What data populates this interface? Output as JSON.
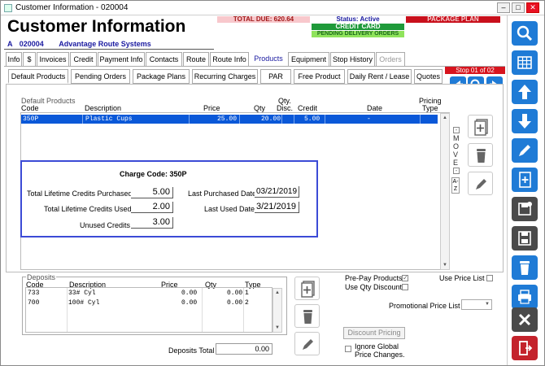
{
  "window": {
    "title": "Customer Information - 020004"
  },
  "header": {
    "title": "Customer Information",
    "account_type": "A",
    "account_number": "020004",
    "account_name": "Advantage Route Systems",
    "total_due": "TOTAL DUE: 620.64",
    "status": "Status: Active",
    "package_plan": "PACKAGE PLAN",
    "credit_card": "CREDIT CARD",
    "pending_orders": "PENDING DELIVERY ORDERS",
    "colors": {
      "total_due_bg": "#f8c8cc",
      "status_fg": "#1a1aa0",
      "package_bg": "#c9101c",
      "credit_bg": "#1f9a3a",
      "pending_bg": "#8fe35b"
    }
  },
  "tabs": [
    "Info",
    "$",
    "Invoices",
    "Credit",
    "Payment Info",
    "Contacts",
    "Route",
    "Route Info",
    "Products",
    "Equipment",
    "Stop History",
    "Orders"
  ],
  "subtabs": [
    "Default Products",
    "Pending Orders",
    "Package Plans",
    "Recurring Charges",
    "PAR",
    "Free Product",
    "Daily Rent / Lease",
    "Quotes"
  ],
  "stop_counter": "Stop  01  of  02",
  "default_products": {
    "group_label": "Default Products",
    "columns": {
      "code": "Code",
      "description": "Description",
      "price": "Price",
      "qty": "Qty",
      "qty_disc_top": "Qty.",
      "qty_disc_bottom": "Disc.",
      "credit": "Credit",
      "date": "Date",
      "pricing_top": "Pricing",
      "pricing_bottom": "Type"
    },
    "rows": [
      {
        "code": "350P",
        "description": "Plastic Cups",
        "price": "25.00",
        "qty": "20.00",
        "credit": "5.00",
        "date": "-"
      }
    ],
    "move_letters": [
      "M",
      "O",
      "V",
      "E"
    ],
    "az_label": "A-Z"
  },
  "charge_code": {
    "title": "Charge Code:",
    "code": "350P",
    "purchased_label": "Total Lifetime Credits Purchased",
    "purchased_value": "5.00",
    "used_label": "Total Lifetime Credits Used",
    "used_value": "2.00",
    "unused_label": "Unused Credits",
    "unused_value": "3.00",
    "last_purchased_label": "Last Purchased Date",
    "last_purchased_value": "03/21/2019",
    "last_used_label": "Last Used Date",
    "last_used_value": "3/21/2019"
  },
  "deposits": {
    "group_label": "Deposits",
    "columns": {
      "code": "Code",
      "description": "Description",
      "price": "Price",
      "qty": "Qty",
      "type": "Type"
    },
    "rows": [
      {
        "code": "733",
        "description": "33# Cyl",
        "price": "0.00",
        "qty": "0.00",
        "type": "1"
      },
      {
        "code": "700",
        "description": "100# Cyl",
        "price": "0.00",
        "qty": "0.00",
        "type": "2"
      }
    ],
    "total_label": "Deposits Total",
    "total_value": "0.00"
  },
  "options": {
    "prepay": "Pre-Pay Products",
    "use_qty_discount": "Use Qty Discount",
    "use_price_list": "Use Price List",
    "promo_price_list": "Promotional Price List",
    "discount_pricing": "Discount Pricing",
    "ignore_global_1": "Ignore Global",
    "ignore_global_2": "Price Changes."
  }
}
